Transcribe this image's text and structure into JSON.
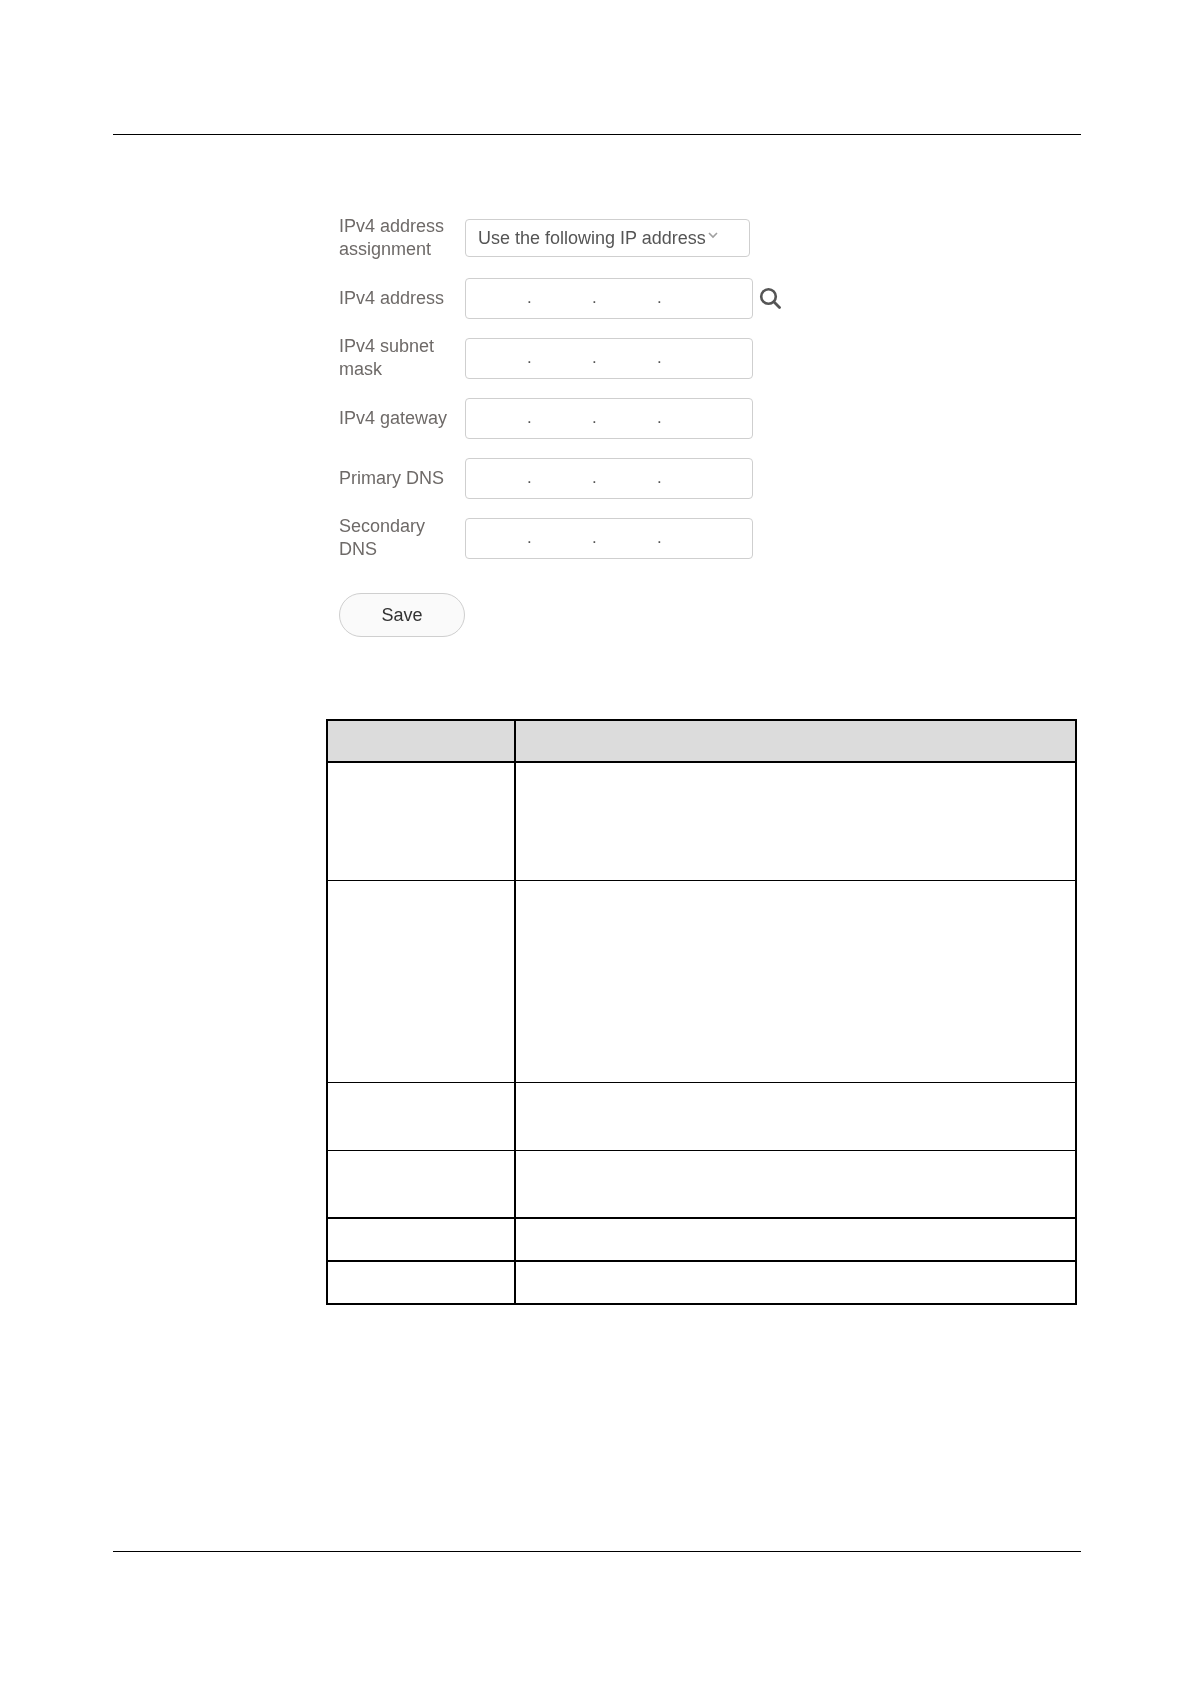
{
  "form": {
    "fields": [
      {
        "kind": "select",
        "label": "IPv4 address assignment",
        "value": "Use the following IP address",
        "search_icon": false
      },
      {
        "kind": "ip",
        "label": "IPv4 address",
        "separators": [
          ".",
          ".",
          "."
        ],
        "search_icon": true
      },
      {
        "kind": "ip",
        "label": "IPv4 subnet mask",
        "separators": [
          ".",
          ".",
          "."
        ],
        "search_icon": false
      },
      {
        "kind": "ip",
        "label": "IPv4 gateway",
        "separators": [
          ".",
          ".",
          "."
        ],
        "search_icon": false
      },
      {
        "kind": "ip",
        "label": "Primary DNS",
        "separators": [
          ".",
          ".",
          "."
        ],
        "search_icon": false
      },
      {
        "kind": "ip",
        "label": "Secondary DNS",
        "separators": [
          ".",
          ".",
          "."
        ],
        "search_icon": false
      }
    ]
  },
  "save_button": {
    "label": "Save"
  }
}
